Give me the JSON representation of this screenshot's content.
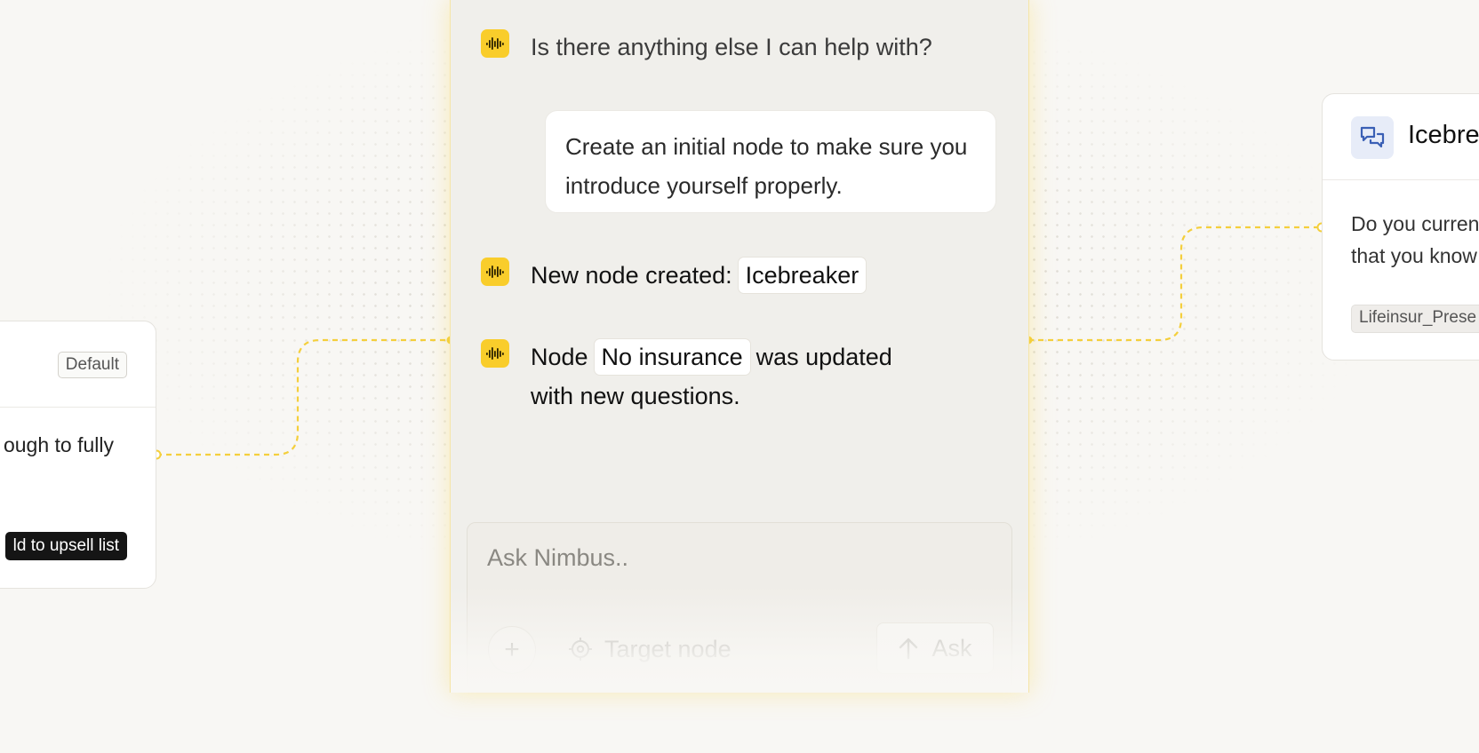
{
  "chat": {
    "messages": [
      {
        "role": "assistant",
        "text": "Is there anything else I can help with?",
        "icon": "nimbus-waveform-icon"
      },
      {
        "role": "user",
        "text": "Create an initial node to make sure you introduce yourself properly."
      },
      {
        "role": "assistant",
        "prefix": "New node created:",
        "chip": "Icebreaker",
        "icon": "nimbus-waveform-icon"
      },
      {
        "role": "assistant",
        "prefix": "Node",
        "chip": "No insurance",
        "suffix_line1": "was updated",
        "suffix_line2": "with new questions.",
        "icon": "nimbus-waveform-icon"
      }
    ],
    "composer": {
      "placeholder": "Ask Nimbus..",
      "add_icon": "plus-icon",
      "target_label": "Target node",
      "target_icon": "crosshair-icon",
      "ask_label": "Ask",
      "ask_icon": "arrow-up-icon"
    }
  },
  "left_card": {
    "badge": "Default",
    "body_text": "ough to fully",
    "tag": "ld to upsell list"
  },
  "right_card": {
    "icon": "chat-bubbles-icon",
    "title": "Icebre",
    "body_line1": "Do you curren",
    "body_line2": "that you know",
    "tag": "Lifeinsur_Prese"
  },
  "colors": {
    "accent_yellow": "#f9cd2b",
    "connector": "#f4cf3c",
    "node_icon_bg": "#e7ecf8",
    "node_icon_fg": "#3a5fb5",
    "panel_bg": "#f0efeb"
  }
}
